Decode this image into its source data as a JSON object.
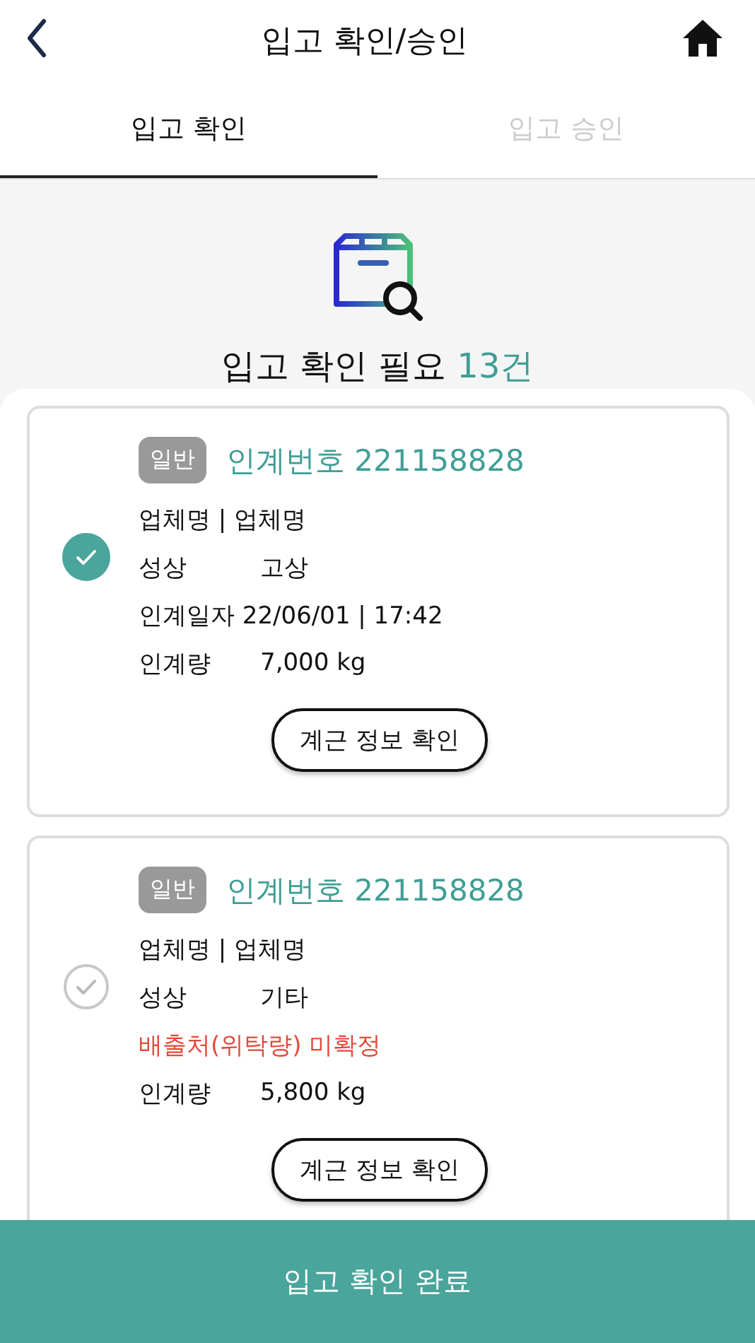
{
  "header": {
    "title": "입고 확인/승인"
  },
  "tabs": [
    {
      "label": "입고 확인",
      "selected": true
    },
    {
      "label": "입고 승인",
      "selected": false
    }
  ],
  "summary": {
    "label": "입고 확인 필요",
    "count": "13건"
  },
  "cards": [
    {
      "checked": true,
      "badge": "일반",
      "number": "인계번호 221158828",
      "rows": [
        {
          "kind": "text",
          "text": "업체명 | 업체명"
        },
        {
          "kind": "pair",
          "label": "성상",
          "value": "고상"
        },
        {
          "kind": "text",
          "text": "인계일자 22/06/01  |  17:42"
        },
        {
          "kind": "pair",
          "label": "인계량",
          "value": "7,000 kg"
        }
      ],
      "button": "계근 정보 확인"
    },
    {
      "checked": false,
      "badge": "일반",
      "number": "인계번호 221158828",
      "rows": [
        {
          "kind": "text",
          "text": "업체명 | 업체명"
        },
        {
          "kind": "pair",
          "label": "성상",
          "value": "기타"
        },
        {
          "kind": "warning",
          "text": "배출처(위탁량) 미확정"
        },
        {
          "kind": "pair",
          "label": "인계량",
          "value": "5,800 kg"
        }
      ],
      "button": "계근 정보 확인"
    }
  ],
  "footer_button": "입고 확인 완료"
}
